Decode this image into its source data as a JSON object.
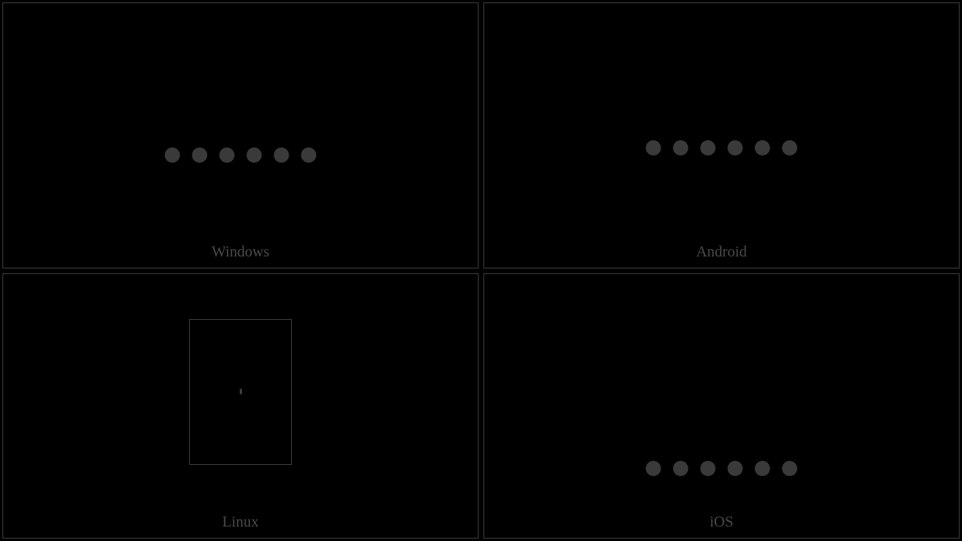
{
  "panels": [
    {
      "label": "Windows"
    },
    {
      "label": "Android"
    },
    {
      "label": "Linux"
    },
    {
      "label": "iOS"
    }
  ],
  "dot_count": 6,
  "colors": {
    "border": "#3a3a3a",
    "label": "#4a4a4a",
    "background": "#000000"
  }
}
